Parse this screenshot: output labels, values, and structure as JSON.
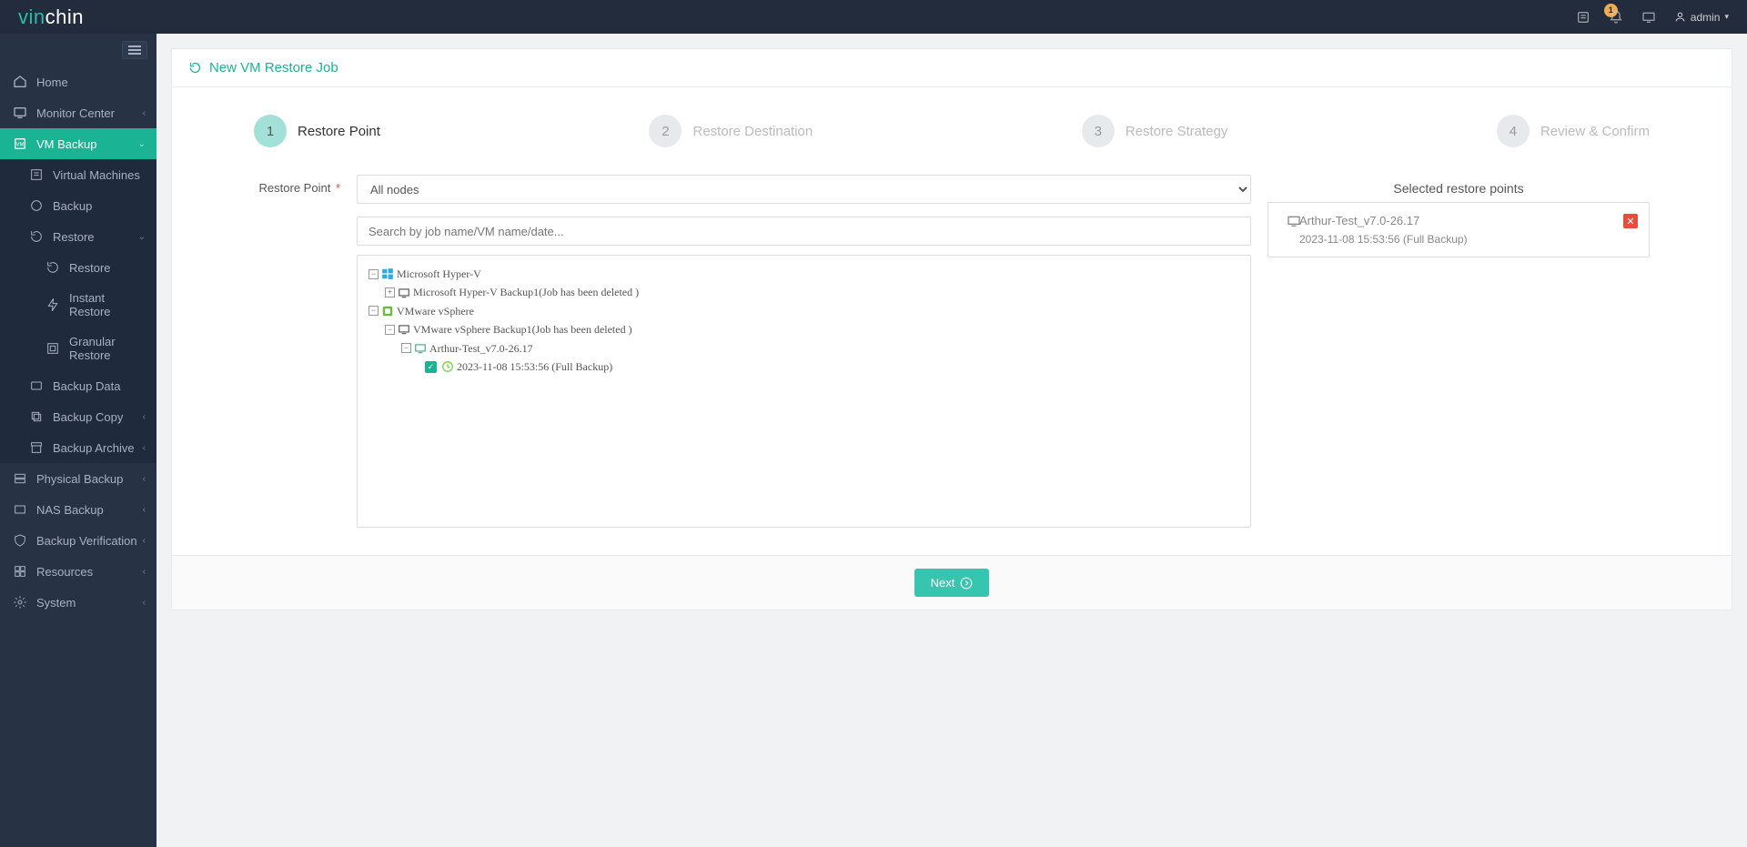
{
  "logo": {
    "part1": "vin",
    "part2": "chin"
  },
  "header": {
    "notif_count": "1",
    "user": "admin"
  },
  "sidebar": {
    "home": "Home",
    "monitor_center": "Monitor Center",
    "vm_backup": "VM Backup",
    "virtual_machines": "Virtual Machines",
    "backup": "Backup",
    "restore": "Restore",
    "restore_sub": "Restore",
    "instant_restore": "Instant Restore",
    "granular_restore": "Granular Restore",
    "backup_data": "Backup Data",
    "backup_copy": "Backup Copy",
    "backup_archive": "Backup Archive",
    "physical_backup": "Physical Backup",
    "nas_backup": "NAS Backup",
    "backup_verification": "Backup Verification",
    "resources": "Resources",
    "system": "System"
  },
  "page": {
    "title": "New VM Restore Job",
    "steps": [
      "Restore Point",
      "Restore Destination",
      "Restore Strategy",
      "Review & Confirm"
    ],
    "form_label": "Restore Point",
    "node_selector": "All nodes",
    "search_placeholder": "Search by job name/VM name/date...",
    "tree": {
      "hyperv": "Microsoft Hyper-V",
      "hyperv_job": "Microsoft Hyper-V Backup1(Job has been deleted )",
      "vsphere": "VMware vSphere",
      "vsphere_job": "VMware vSphere Backup1(Job has been deleted )",
      "vm": "Arthur-Test_v7.0-26.17",
      "point": "2023-11-08 15:53:56 (Full  Backup)"
    },
    "selected_header": "Selected restore points",
    "selected_title": "Arthur-Test_v7.0-26.17",
    "selected_subtitle": "2023-11-08 15:53:56 (Full Backup)",
    "next": "Next"
  }
}
